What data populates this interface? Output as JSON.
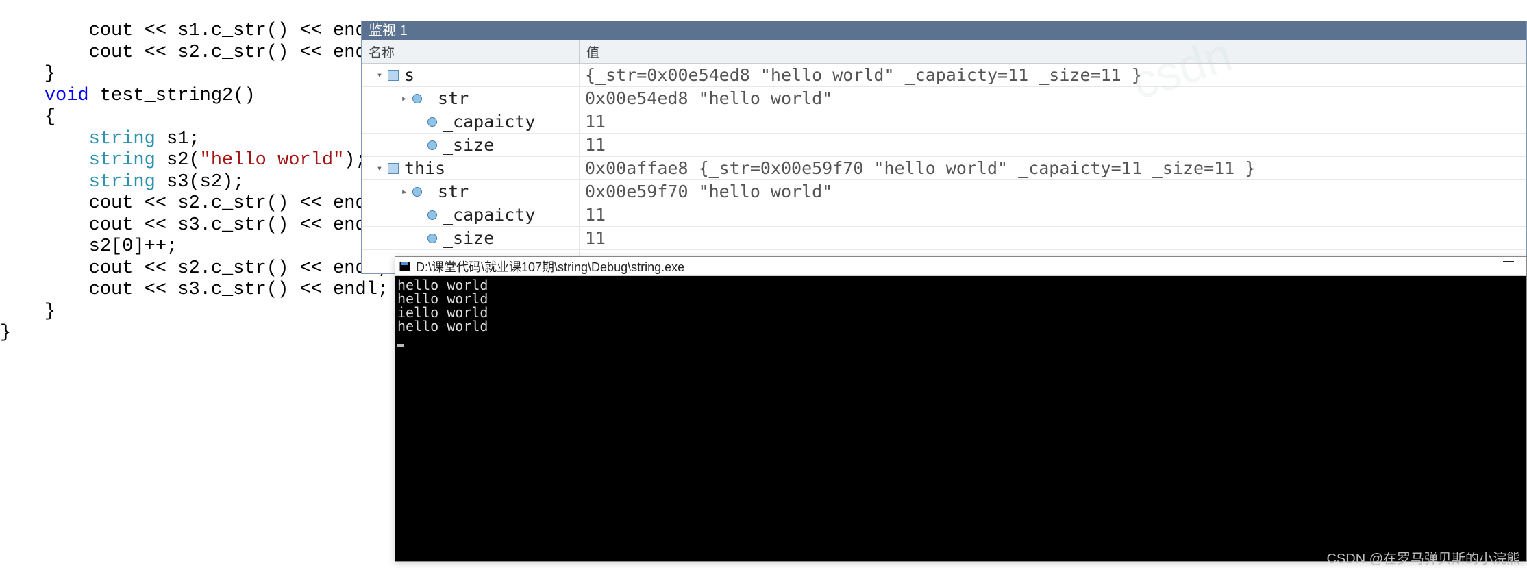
{
  "code": {
    "lines": [
      {
        "indent": 4,
        "tokens": [
          {
            "t": "cout << s1.",
            "c": "k-ident"
          },
          {
            "t": "c_str",
            "c": "k-func"
          },
          {
            "t": "() << ",
            "c": "k-ident"
          },
          {
            "t": "endl",
            "c": "k-endl"
          },
          {
            "t": ";",
            "c": "k-punct"
          }
        ]
      },
      {
        "indent": 4,
        "tokens": [
          {
            "t": "cout << s2.",
            "c": "k-ident"
          },
          {
            "t": "c_str",
            "c": "k-func"
          },
          {
            "t": "() << ",
            "c": "k-ident"
          },
          {
            "t": "endl",
            "c": "k-endl"
          },
          {
            "t": ";",
            "c": "k-punct"
          }
        ]
      },
      {
        "indent": 2,
        "tokens": [
          {
            "t": "}",
            "c": "k-punct"
          }
        ]
      },
      {
        "indent": 0,
        "tokens": []
      },
      {
        "indent": 2,
        "tokens": [
          {
            "t": "void ",
            "c": "k-keyword"
          },
          {
            "t": "test_string2",
            "c": "k-func"
          },
          {
            "t": "()",
            "c": "k-punct"
          }
        ]
      },
      {
        "indent": 2,
        "tokens": [
          {
            "t": "{",
            "c": "k-punct"
          }
        ]
      },
      {
        "indent": 4,
        "tokens": [
          {
            "t": "string",
            "c": "k-type"
          },
          {
            "t": " s1;",
            "c": "k-ident"
          }
        ]
      },
      {
        "indent": 4,
        "tokens": [
          {
            "t": "string",
            "c": "k-type"
          },
          {
            "t": " s2(",
            "c": "k-ident"
          },
          {
            "t": "\"hello world\"",
            "c": "k-str"
          },
          {
            "t": ");",
            "c": "k-punct"
          }
        ]
      },
      {
        "indent": 0,
        "tokens": []
      },
      {
        "indent": 4,
        "tokens": [
          {
            "t": "string",
            "c": "k-type"
          },
          {
            "t": " s3(s2);",
            "c": "k-ident"
          }
        ]
      },
      {
        "indent": 4,
        "tokens": [
          {
            "t": "cout << s2.",
            "c": "k-ident"
          },
          {
            "t": "c_str",
            "c": "k-func"
          },
          {
            "t": "() << ",
            "c": "k-ident"
          },
          {
            "t": "endl",
            "c": "k-endl"
          },
          {
            "t": ";",
            "c": "k-punct"
          }
        ]
      },
      {
        "indent": 4,
        "tokens": [
          {
            "t": "cout << s3.",
            "c": "k-ident"
          },
          {
            "t": "c_str",
            "c": "k-func"
          },
          {
            "t": "() << ",
            "c": "k-ident"
          },
          {
            "t": "endl",
            "c": "k-endl"
          },
          {
            "t": ";",
            "c": "k-punct"
          }
        ]
      },
      {
        "indent": 0,
        "tokens": []
      },
      {
        "indent": 4,
        "tokens": [
          {
            "t": "s2[0]++;",
            "c": "k-ident"
          }
        ]
      },
      {
        "indent": 4,
        "tokens": [
          {
            "t": "cout << s2.",
            "c": "k-ident"
          },
          {
            "t": "c_str",
            "c": "k-func"
          },
          {
            "t": "() << ",
            "c": "k-ident"
          },
          {
            "t": "endl",
            "c": "k-endl"
          },
          {
            "t": ";",
            "c": "k-punct"
          }
        ]
      },
      {
        "indent": 4,
        "tokens": [
          {
            "t": "cout << s3.",
            "c": "k-ident"
          },
          {
            "t": "c_str",
            "c": "k-func"
          },
          {
            "t": "() << ",
            "c": "k-ident"
          },
          {
            "t": "endl",
            "c": "k-endl"
          },
          {
            "t": ";",
            "c": "k-punct"
          }
        ]
      },
      {
        "indent": 2,
        "tokens": [
          {
            "t": "}",
            "c": "k-punct"
          }
        ]
      },
      {
        "indent": 0,
        "tokens": [
          {
            "t": "}",
            "c": "k-punct"
          }
        ]
      }
    ]
  },
  "watch": {
    "title": "监视 1",
    "columns": {
      "name": "名称",
      "value": "值"
    },
    "rows": [
      {
        "depth": 0,
        "expander": "▾",
        "icon": "struct",
        "name": "s",
        "value": "{_str=0x00e54ed8 \"hello world\" _capaicty=11 _size=11 }"
      },
      {
        "depth": 1,
        "expander": "▸",
        "icon": "member",
        "name": "_str",
        "value": "0x00e54ed8 \"hello world\""
      },
      {
        "depth": 2,
        "expander": "",
        "icon": "member",
        "name": "_capaicty",
        "value": "11"
      },
      {
        "depth": 2,
        "expander": "",
        "icon": "member",
        "name": "_size",
        "value": "11"
      },
      {
        "depth": 0,
        "expander": "▾",
        "icon": "struct",
        "name": "this",
        "value": "0x00affae8 {_str=0x00e59f70 \"hello world\" _capaicty=11 _size=11 }"
      },
      {
        "depth": 1,
        "expander": "▸",
        "icon": "member",
        "name": "_str",
        "value": "0x00e59f70 \"hello world\""
      },
      {
        "depth": 2,
        "expander": "",
        "icon": "member",
        "name": "_capaicty",
        "value": "11"
      },
      {
        "depth": 2,
        "expander": "",
        "icon": "member",
        "name": "_size",
        "value": "11"
      }
    ]
  },
  "console": {
    "title": "D:\\课堂代码\\就业课107期\\string\\Debug\\string.exe",
    "lines": [
      "hello world",
      "hello world",
      "iello world",
      "hello world"
    ]
  },
  "watermark": "CSDN @在罗马弹贝斯的小浣熊",
  "watermark_bg": "csdn"
}
